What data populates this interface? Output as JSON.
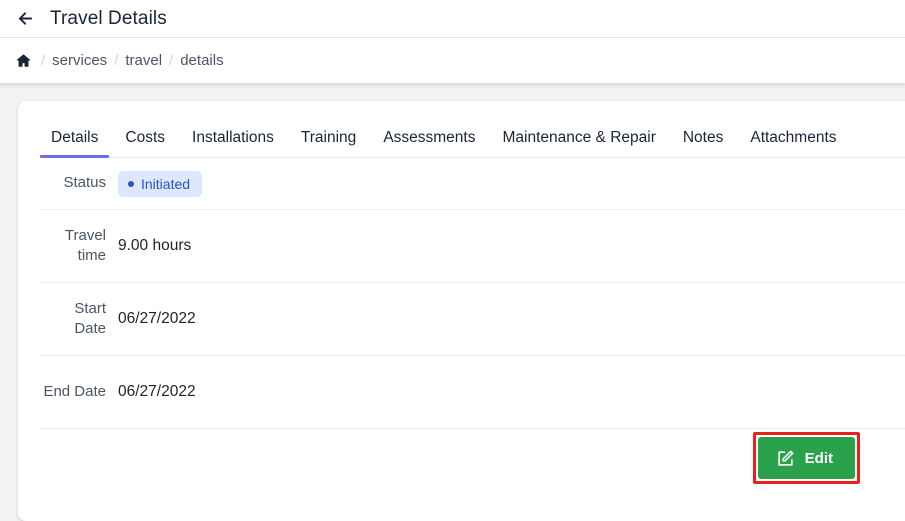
{
  "header": {
    "back_icon": "arrow-left-icon",
    "title": "Travel Details"
  },
  "breadcrumb": {
    "home_icon": "home-icon",
    "separator": "/",
    "items": [
      {
        "label": "services"
      },
      {
        "label": "travel"
      },
      {
        "label": "details"
      }
    ]
  },
  "tabs": [
    {
      "label": "Details",
      "active": true
    },
    {
      "label": "Costs",
      "active": false
    },
    {
      "label": "Installations",
      "active": false
    },
    {
      "label": "Training",
      "active": false
    },
    {
      "label": "Assessments",
      "active": false
    },
    {
      "label": "Maintenance & Repair",
      "active": false
    },
    {
      "label": "Notes",
      "active": false
    },
    {
      "label": "Attachments",
      "active": false
    }
  ],
  "details": {
    "rows": [
      {
        "label": "Status",
        "value": "Initiated"
      },
      {
        "label": "Travel time",
        "value": "9.00 hours"
      },
      {
        "label": "Start Date",
        "value": "06/27/2022"
      },
      {
        "label": "End Date",
        "value": "06/27/2022"
      }
    ]
  },
  "footer": {
    "edit_label": "Edit",
    "edit_icon": "pencil-square-icon"
  },
  "colors": {
    "accent": "#6c6cf0",
    "badge_bg": "#dce8fb",
    "badge_fg": "#2f50c8",
    "edit_green": "#2ba14b",
    "highlight_red": "#e8211c",
    "page_bg": "#f1f2f4"
  }
}
